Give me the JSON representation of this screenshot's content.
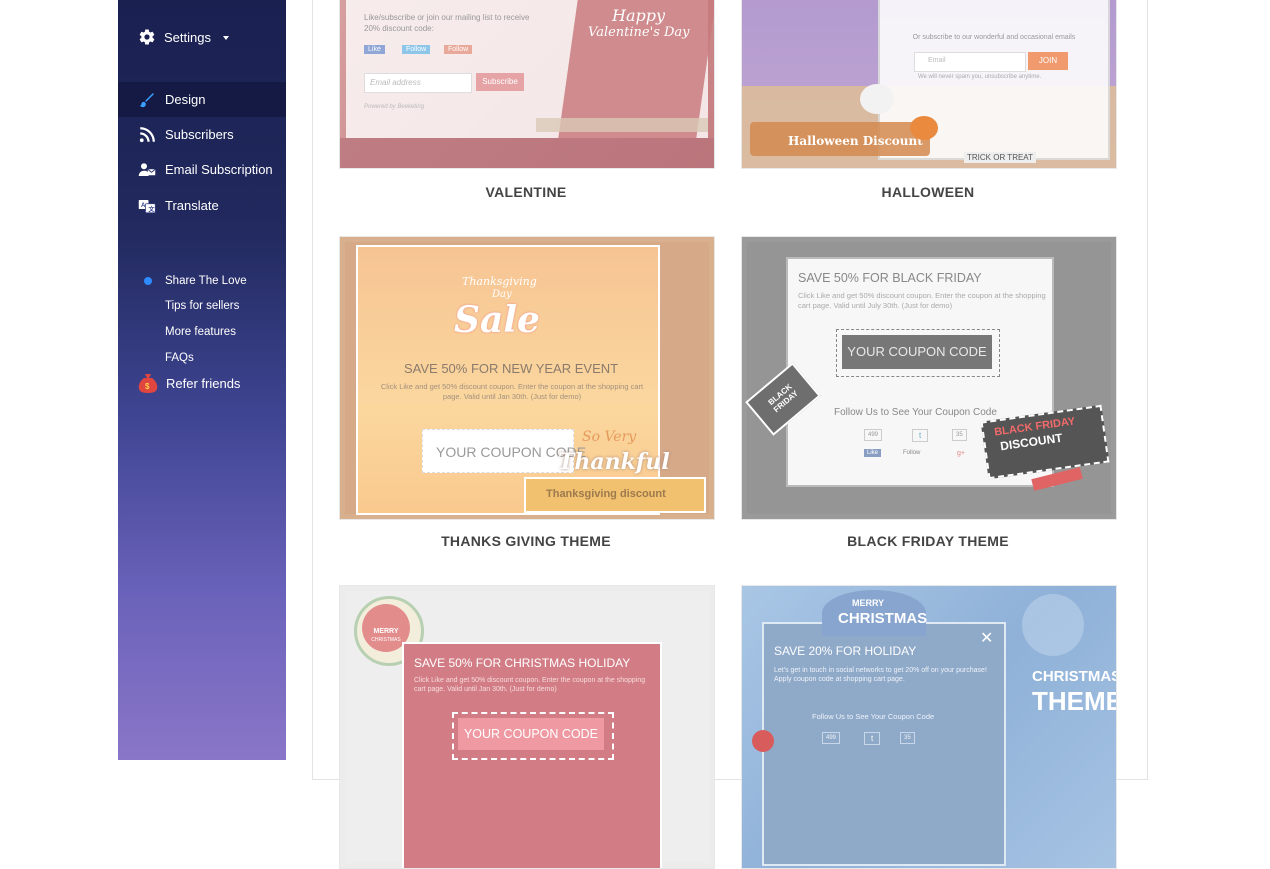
{
  "sidebar": {
    "settings_label": "Settings",
    "nav": [
      {
        "label": "Design",
        "icon": "brush-icon"
      },
      {
        "label": "Subscribers",
        "icon": "rss-icon"
      },
      {
        "label": "Email Subscription",
        "icon": "user-mail-icon"
      },
      {
        "label": "Translate",
        "icon": "translate-icon"
      }
    ],
    "sub": [
      {
        "label": "Share The Love"
      },
      {
        "label": "Tips for sellers"
      },
      {
        "label": "More features"
      },
      {
        "label": "FAQs"
      }
    ],
    "refer_label": "Refer friends"
  },
  "themes": [
    {
      "label": "VALENTINE",
      "preview": {
        "text": "Like/subscribe or join our mailing list to receive 20% discount code:",
        "like": "Like",
        "follow": "Follow",
        "gfollow": "Follow",
        "email_placeholder": "Email address",
        "button": "Subscribe",
        "powered": "Powered by Beeketing",
        "script1": "Happy",
        "script2": "Valentine's Day"
      }
    },
    {
      "label": "HALLOWEEN",
      "preview": {
        "subscribe_text": "Or subscribe to our wonderful and occasional emails",
        "email_placeholder": "Email",
        "button": "JOIN",
        "spam_text": "We will never spam you, unsubscribe anytime.",
        "banner": "Halloween Discount",
        "trick": "TRICK OR TREAT"
      }
    },
    {
      "label": "THANKS GIVING THEME",
      "preview": {
        "script1": "Thanksgiving",
        "script2": "Day",
        "sale": "Sale",
        "title": "SAVE 50% FOR NEW YEAR EVENT",
        "body": "Click Like and get 50% discount coupon. Enter the coupon at the shopping cart page. Valid until Jan 30th. (Just for demo)",
        "coupon": "YOUR COUPON CODE",
        "so_very": "So Very",
        "thankful": "Thankful",
        "banner": "Thanksgiving discount"
      }
    },
    {
      "label": "BLACK FRIDAY THEME",
      "preview": {
        "title": "SAVE 50% FOR BLACK FRIDAY",
        "body": "Click Like and get 50% discount coupon. Enter the coupon at the shopping cart page. Valid until July 30th. (Just for demo)",
        "coupon": "YOUR COUPON CODE",
        "tag": "BLACK FRIDAY",
        "follow": "Follow Us to See Your Coupon Code",
        "count1": "499",
        "count2": "35",
        "like": "Like",
        "tw": "Follow",
        "discount1": "BLACK FRIDAY",
        "discount2": "DISCOUNT"
      }
    },
    {
      "label": "",
      "preview": {
        "badge1": "MERRY",
        "badge2": "CHRISTMAS",
        "title": "SAVE 50% FOR CHRISTMAS HOLIDAY",
        "body": "Click Like and get 50% discount coupon. Enter the coupon at the shopping cart page. Valid until Jan 30th. (Just for demo)",
        "coupon": "YOUR COUPON CODE"
      }
    },
    {
      "label": "",
      "preview": {
        "merry": "MERRY",
        "christmas": "CHRISTMAS",
        "title": "SAVE 20% FOR HOLIDAY",
        "body": "Let's get in touch in social networks to get 20% off on your purchase! Apply coupon code at shopping cart page.",
        "follow": "Follow Us to See Your Coupon Code",
        "count1": "499",
        "count2": "35",
        "theme1": "CHRISTMAS",
        "theme2": "THEME"
      }
    }
  ],
  "colors": {
    "sidebar_top": "#1a2050",
    "sidebar_bottom": "#8a76c8",
    "active_nav": "#141a44",
    "dot": "#2f8cff"
  }
}
